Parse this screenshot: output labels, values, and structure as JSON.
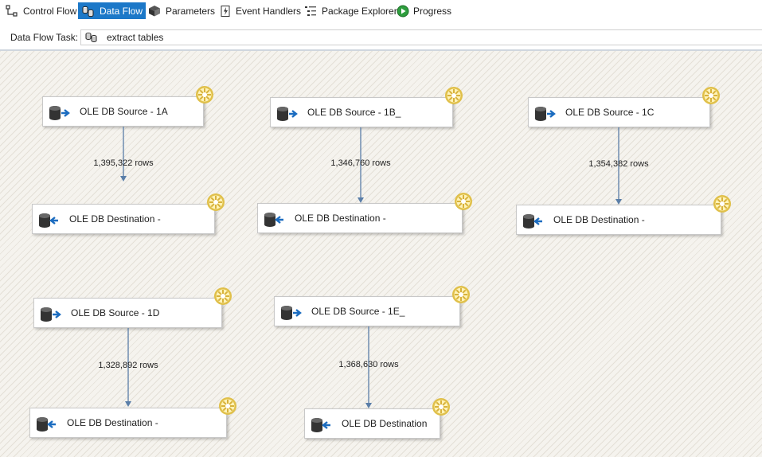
{
  "toolbar": {
    "tabs": [
      {
        "label": "Control Flow",
        "icon": "control-flow-icon",
        "active": false
      },
      {
        "label": "Data Flow",
        "icon": "data-flow-icon",
        "active": true
      },
      {
        "label": "Parameters",
        "icon": "parameters-icon",
        "active": false
      },
      {
        "label": "Event Handlers",
        "icon": "event-handlers-icon",
        "active": false
      },
      {
        "label": "Package Explorer",
        "icon": "package-explorer-icon",
        "active": false
      },
      {
        "label": "Progress",
        "icon": "progress-icon",
        "active": false
      }
    ]
  },
  "task": {
    "label": "Data Flow Task:",
    "value": "extract tables"
  },
  "colors": {
    "active_tab": "#1c78c8",
    "arrow": "#5a7ea8",
    "gear": "#f2d35a"
  },
  "flows": [
    {
      "source": "OLE DB Source - 1A",
      "destination": "OLE DB Destination -",
      "rows": "1,395,322 rows"
    },
    {
      "source": "OLE DB Source - 1B_",
      "destination": "OLE DB Destination -",
      "rows": "1,346,760 rows"
    },
    {
      "source": "OLE DB Source - 1C",
      "destination": "OLE DB Destination -",
      "rows": "1,354,382 rows"
    },
    {
      "source": "OLE DB Source - 1D",
      "destination": "OLE DB Destination -",
      "rows": "1,328,892 rows"
    },
    {
      "source": "OLE DB Source - 1E_",
      "destination": "OLE DB Destination",
      "rows": "1,368,630 rows"
    }
  ]
}
